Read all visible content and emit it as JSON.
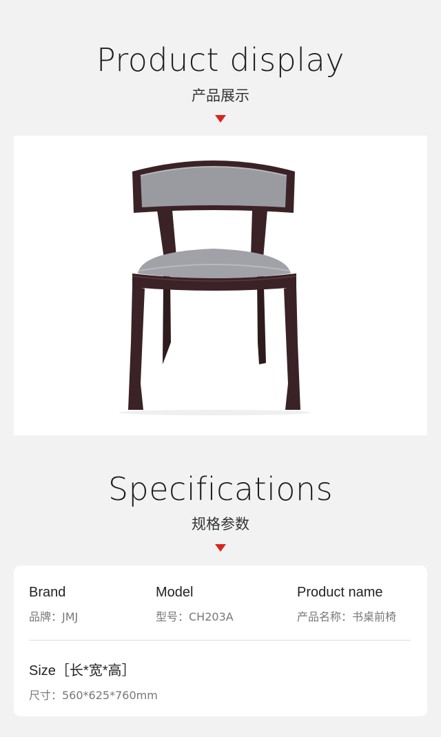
{
  "display": {
    "title": "Product display",
    "subtitle": "产品展示"
  },
  "specs_section": {
    "title": "Specifications",
    "subtitle": "规格参数"
  },
  "specs": {
    "brand_label": "Brand",
    "brand_value": "品牌：JMJ",
    "model_label": "Model",
    "model_value": "型号：CH203A",
    "name_label": "Product name",
    "name_value": "产品名称：书桌前椅",
    "size_label": "Size［长*宽*高］",
    "size_value": "尺寸：560*625*760mm"
  },
  "colors": {
    "accent_arrow": "#d6261c",
    "background": "#f2f2f2",
    "card": "#ffffff",
    "chair_wood": "#3a2226",
    "chair_fabric": "#9a9ba1"
  },
  "icons": {
    "arrow": "triangle-down-icon"
  }
}
